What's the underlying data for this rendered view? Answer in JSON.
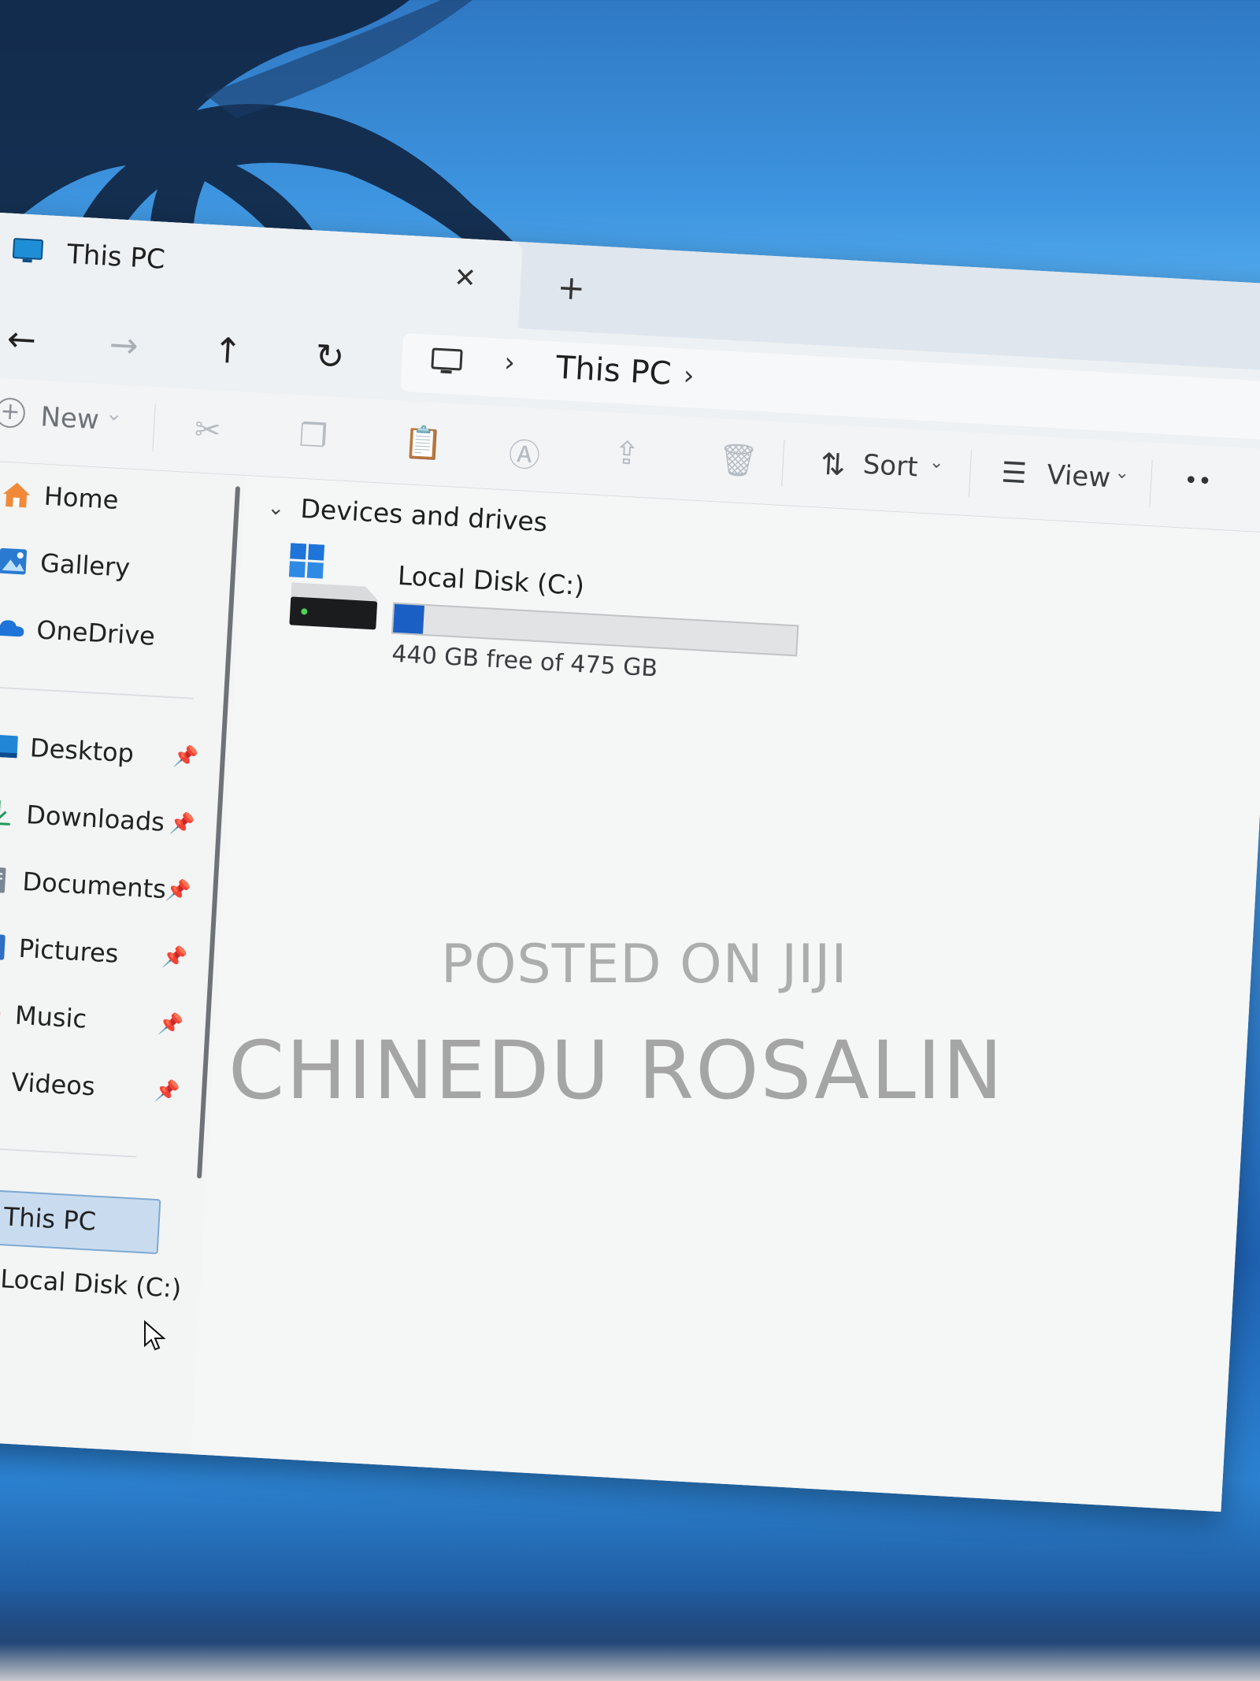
{
  "window": {
    "tab_title": "This PC",
    "new_tab_label": "+",
    "close_tab_label": "✕"
  },
  "nav": {
    "back": "←",
    "forward": "→",
    "up": "↑",
    "refresh": "↻",
    "separator": "›",
    "breadcrumb": "This PC"
  },
  "command_bar": {
    "new_label": "New",
    "sort_label": "Sort",
    "view_label": "View",
    "more_label": "••"
  },
  "sidebar": {
    "top_items": [
      {
        "label": "Home"
      },
      {
        "label": "Gallery"
      },
      {
        "label": "OneDrive"
      }
    ],
    "quick_access": [
      {
        "label": "Desktop"
      },
      {
        "label": "Downloads"
      },
      {
        "label": "Documents"
      },
      {
        "label": "Pictures"
      },
      {
        "label": "Music"
      },
      {
        "label": "Videos"
      }
    ],
    "bottom_items": [
      {
        "label": "This PC",
        "selected": true
      },
      {
        "label": "Local Disk (C:)"
      }
    ]
  },
  "content": {
    "group_title": "Devices and drives",
    "drive": {
      "name": "Local Disk (C:)",
      "free_text": "440 GB free of 475 GB",
      "used_fraction": 0.074
    }
  },
  "watermark": {
    "line1": "POSTED ON JIJI",
    "line2": "CHINEDU ROSALIN"
  },
  "colors": {
    "accent": "#1a5fc4",
    "selection": "#c9dcef",
    "window_bg": "#f3f4f4"
  }
}
